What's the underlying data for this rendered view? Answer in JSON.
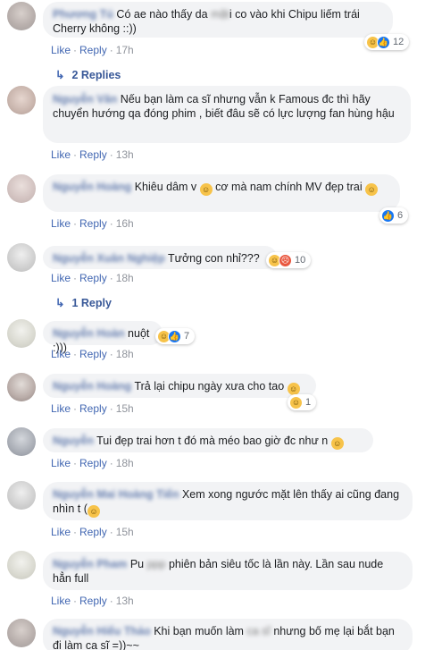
{
  "actions": {
    "like": "Like",
    "reply": "Reply",
    "sep": "·"
  },
  "comments": [
    {
      "name": "Phương Tú",
      "text_a": "Có ae nào thấy da ",
      "blur": "mặt",
      "text_b": "i co vào khi Chipu liếm trái Cherry không ::))",
      "time": "17h",
      "reaction_count": "12",
      "replies": "2 Replies"
    },
    {
      "name": "Nguyễn Văn",
      "text": "Nếu bạn làm ca sĩ nhưng vẫn k Famous đc thì hãy chuyển hướng qa đóng phim , biết đâu sẽ có lực lượng fan hùng hậu",
      "time": "13h"
    },
    {
      "name": "Nguyễn Hoàng",
      "text_a": "Khiêu dâm v",
      "text_b": " cơ mà nam chính MV đẹp trai ",
      "time": "16h",
      "reaction_count": "6"
    },
    {
      "name": "Nguyễn Xuân Nghiệp",
      "text": "Tưởng con nhỉ???",
      "time": "18h",
      "reaction_count": "10",
      "replies": "1 Reply"
    },
    {
      "name": "Nguyễn Hoàn",
      "text": "nuột :)))",
      "time": "18h",
      "reaction_count": "7"
    },
    {
      "name": "Nguyễn Hoàng",
      "text": "Trả lại chipu ngày xưa cho tao ",
      "time": "15h",
      "reaction_count": "1"
    },
    {
      "name": "Nguyễn",
      "text": "Tui đẹp trai hơn t đó mà méo bao giờ đc như n ",
      "time": "18h"
    },
    {
      "name": "Nguyễn Mai Hoàng Tiến",
      "text_a": "Xem xong ngước mặt lên thấy ai cũng đang nhìn t (",
      "time": "15h"
    },
    {
      "name": "Nguyễn Pham",
      "text_a": "Pu ",
      "blur": "ppp",
      "text_b": " phiên bản siêu tốc là lần này. Lần sau nude hẳn full",
      "time": "13h"
    },
    {
      "name": "Nguyễn Hiếu Thảo",
      "text_a": "Khi bạn muốn làm ",
      "blur": "ca sĩ",
      "text_b": " nhưng bố mẹ lại bắt bạn đi làm ca sĩ =))~~"
    }
  ],
  "colors": {
    "link": "#385898",
    "bubble": "#f2f3f5",
    "meta": "#90949c",
    "like_blue": "#1877f2",
    "haha_yellow": "#f7c34a"
  },
  "icons": [
    "haha-reaction-icon",
    "like-reaction-icon",
    "angry-reaction-icon",
    "reply-arrow-icon",
    "smile-emoji-icon"
  ]
}
